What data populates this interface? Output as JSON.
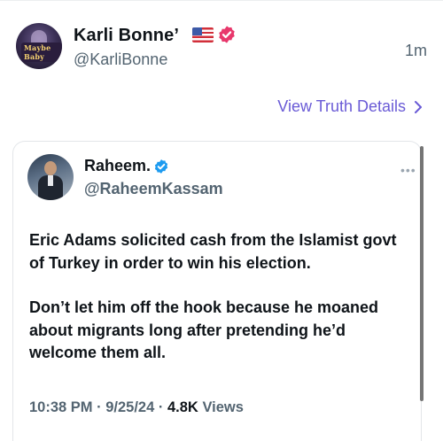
{
  "post": {
    "display_name": "Karli Bonne’",
    "handle": "@KarliBonne",
    "time": "1m",
    "avatar_text": "Maybe Baby",
    "view_details": "View Truth Details",
    "icons": {
      "flag": "us-flag-icon",
      "verified": "verified-badge-icon",
      "chevron": "chevron-right-icon"
    }
  },
  "quoted": {
    "name": "Raheem.",
    "handle": "@RaheemKassam",
    "body": [
      "Eric Adams solicited cash from the Islamist govt of Turkey in order to win his election.",
      "Don’t let him off the hook because he moaned about migrants long after pretending he’d welcome them all."
    ],
    "meta": {
      "time": "10:38 PM",
      "date": "9/25/24",
      "views_count": "4.8K",
      "views_label": "Views"
    }
  },
  "colors": {
    "link": "#6a5bd6",
    "verified_pink": "#e8386c",
    "verified_blue": "#1d9bf0",
    "secondary_text": "#536471"
  }
}
